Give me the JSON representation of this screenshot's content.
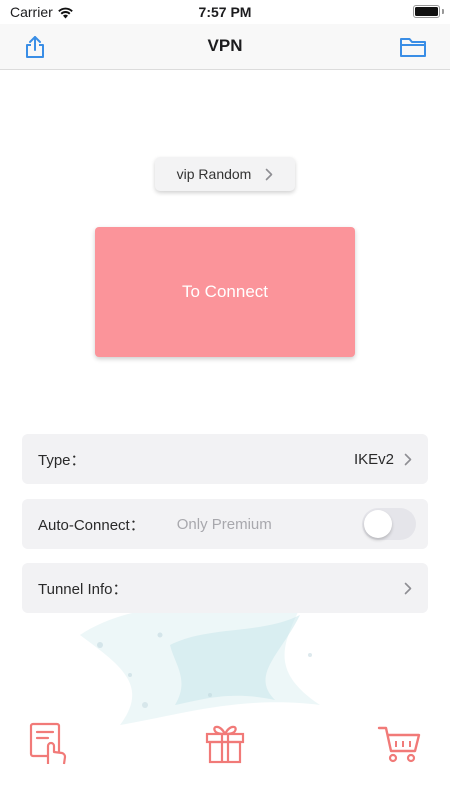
{
  "status_bar": {
    "carrier": "Carrier",
    "time": "7:57 PM"
  },
  "nav": {
    "title": "VPN",
    "left_icon": "share-icon",
    "right_icon": "folder-icon"
  },
  "server": {
    "label": "vip Random"
  },
  "connect": {
    "label": "To Connect"
  },
  "settings": {
    "type": {
      "label": "Type：",
      "value": "IKEv2"
    },
    "auto_connect": {
      "label": "Auto-Connect：",
      "note": "Only Premium",
      "enabled": false
    },
    "tunnel_info": {
      "label": "Tunnel Info："
    }
  },
  "tab_bar": {
    "items": [
      "guide-icon",
      "gift-icon",
      "cart-icon"
    ]
  },
  "colors": {
    "accent": "#3a8ee6",
    "connect": "#fb949a",
    "tab_icon": "#f17a78"
  }
}
